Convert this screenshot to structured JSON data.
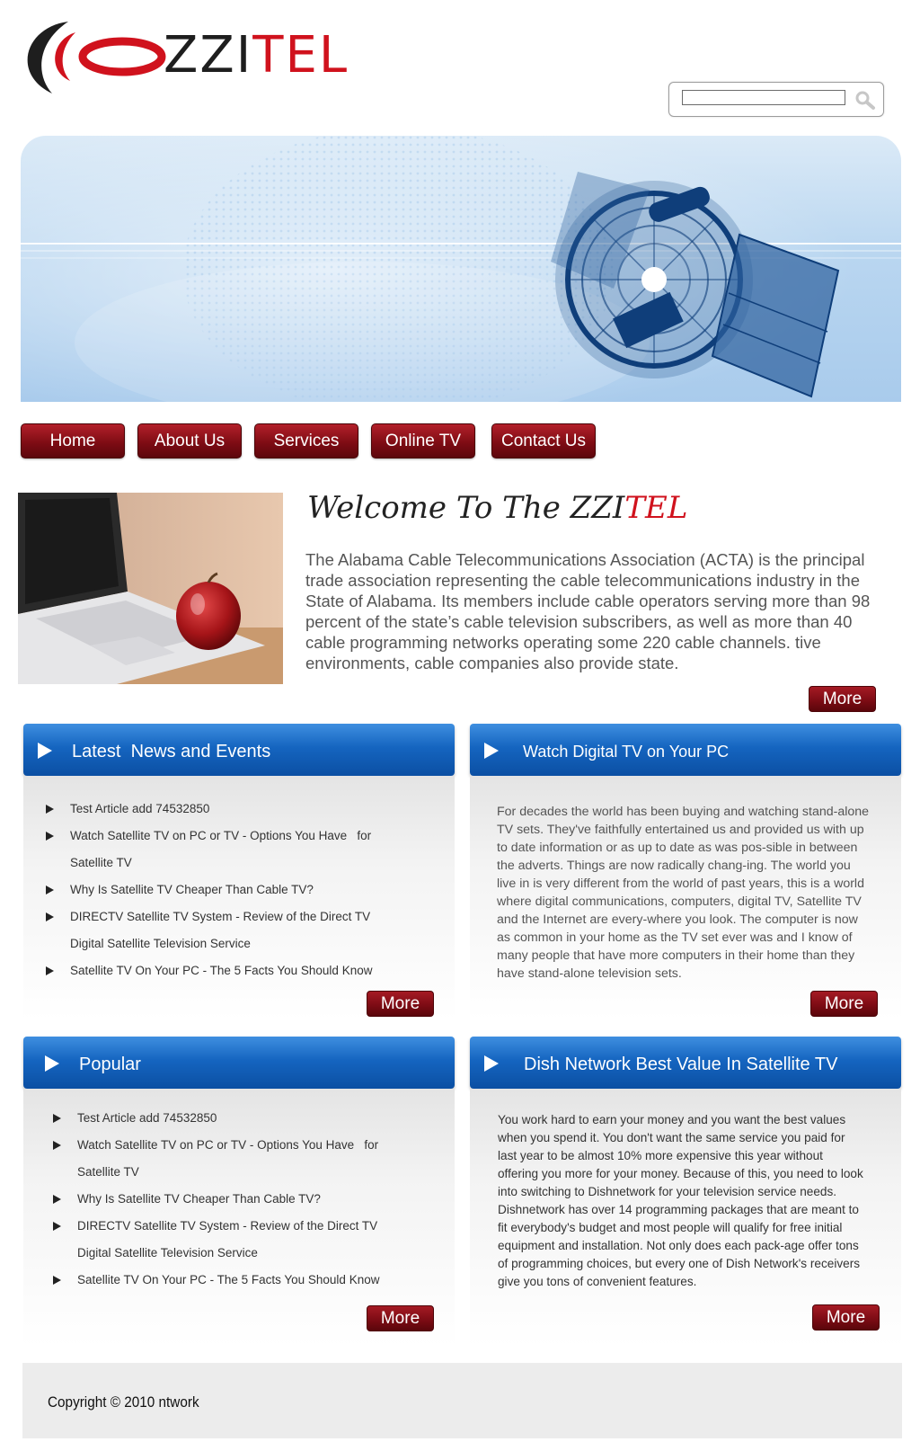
{
  "logo": {
    "text_zz": "ZZI",
    "text_tel": "TEL"
  },
  "search": {
    "value": "",
    "placeholder": ""
  },
  "nav": [
    {
      "label": "Home"
    },
    {
      "label": "About Us"
    },
    {
      "label": "Services"
    },
    {
      "label": "Online TV"
    },
    {
      "label": "Contact Us"
    }
  ],
  "welcome": {
    "title_prefix": "Welcome To The ",
    "title_zz": "ZZI",
    "title_tel": "TEL",
    "text": "The Alabama Cable Telecommunications Association (ACTA) is the principal trade association representing the cable telecommunications industry in the State of Alabama. Its members include cable operators serving more than 98 percent of the state’s cable television subscribers, as well as more than 40 cable programming networks operating some 220 cable channels. tive environments, cable companies also provide state.",
    "more_label": "More"
  },
  "latest_news": {
    "title": "Latest  News and Events",
    "items": [
      "Test Article add 74532850",
      "Watch Satellite TV on PC or TV - Options You Have   for",
      "Satellite TV",
      "Why Is Satellite TV Cheaper Than Cable TV?",
      "DIRECTV Satellite TV System - Review of the Direct TV",
      "Digital Satellite Television Service",
      "Satellite TV On Your PC - The 5 Facts You Should Know"
    ],
    "more_label": "More"
  },
  "watch_tv": {
    "title": "Watch Digital TV on Your PC",
    "text": "For decades the world has been buying and watching stand-alone TV sets. They've faithfully entertained us and provided us with up to date information or as up to date as was pos-sible in between the adverts. Things are now radically chang-ing. The world you live in is very different from the world of past years, this is a world where digital communications, computers, digital TV, Satellite TV and the Internet are every-where you look. The computer is now as common in your home as the TV set ever was and I know of many people that have more computers in their home than they have stand-alone television sets.",
    "more_label": "More"
  },
  "popular": {
    "title": "Popular",
    "items": [
      "Test Article add 74532850",
      "Watch Satellite TV on PC or TV - Options You Have   for",
      "Satellite TV",
      "Why Is Satellite TV Cheaper Than Cable TV?",
      "DIRECTV Satellite TV System - Review of the Direct TV",
      "Digital Satellite Television Service",
      "Satellite TV On Your PC - The 5 Facts You Should Know"
    ],
    "more_label": "More"
  },
  "dish": {
    "title": "Dish Network Best Value In Satellite TV",
    "text": "You work hard to earn your money and you want the best values when you spend it. You don't want the same service you paid for last year to be almost 10% more expensive this year without offering you more for your money. Because of this, you need to look into switching to Dishnetwork for your television service needs. Dishnetwork has over 14 programming packages that are meant to fit everybody's budget and most people will qualify for free initial equipment and installation. Not only does each pack-age offer tons of programming choices, but every one of Dish Network's receivers give you tons of convenient features.",
    "more_label": "More"
  },
  "footer": {
    "copyright": "Copyright © 2010 ntwork"
  },
  "colors": {
    "brand_red": "#d0121d",
    "nav_red": "#7f0c14",
    "panel_blue": "#1565c0"
  }
}
